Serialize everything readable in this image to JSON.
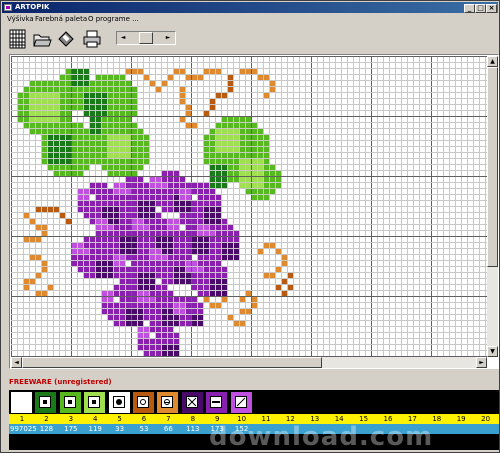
{
  "window": {
    "title": "ARTOPIK",
    "controls": {
      "minimize": "_",
      "maximize": "□",
      "close": "×"
    }
  },
  "menu": [
    "Výšivka",
    "Farebná paleta",
    "O programe ..."
  ],
  "toolbar": {
    "tools": [
      "grid-icon",
      "open-folder-icon",
      "save-disk-icon",
      "print-icon"
    ],
    "slider_arrows": {
      "left": "◄",
      "right": "►"
    }
  },
  "status": {
    "license": "FREEWARE (unregistered)"
  },
  "palette": {
    "swatches": [
      {
        "index": "1",
        "color": "#ffffff",
        "symbol": "none",
        "value": "997025"
      },
      {
        "index": "2",
        "color": "#1a7a1a",
        "symbol": "dot-square",
        "value": "128"
      },
      {
        "index": "3",
        "color": "#58b820",
        "symbol": "dot-square",
        "value": "175"
      },
      {
        "index": "4",
        "color": "#a0e050",
        "symbol": "dot-square",
        "value": "119"
      },
      {
        "index": "5",
        "color": "#ffffff",
        "symbol": "dot",
        "value": "33"
      },
      {
        "index": "6",
        "color": "#b85a10",
        "symbol": "circle",
        "value": "53"
      },
      {
        "index": "7",
        "color": "#e08a30",
        "symbol": "minus-circle",
        "value": "66"
      },
      {
        "index": "8",
        "color": "#4a0a6a",
        "symbol": "x",
        "value": "113"
      },
      {
        "index": "9",
        "color": "#8a20b0",
        "symbol": "minus",
        "value": "173"
      },
      {
        "index": "10",
        "color": "#c050e0",
        "symbol": "slash",
        "value": "152"
      }
    ],
    "extra_indices": [
      "11",
      "12",
      "13",
      "14",
      "15",
      "16",
      "17",
      "18",
      "19",
      "20"
    ]
  },
  "watermark": "download.com",
  "colors": {
    "title_start": "#0a246a",
    "title_end": "#3a6ea5",
    "license_text": "#c00000",
    "index_row": "#fff200",
    "value_row": "#3aa0d0"
  }
}
